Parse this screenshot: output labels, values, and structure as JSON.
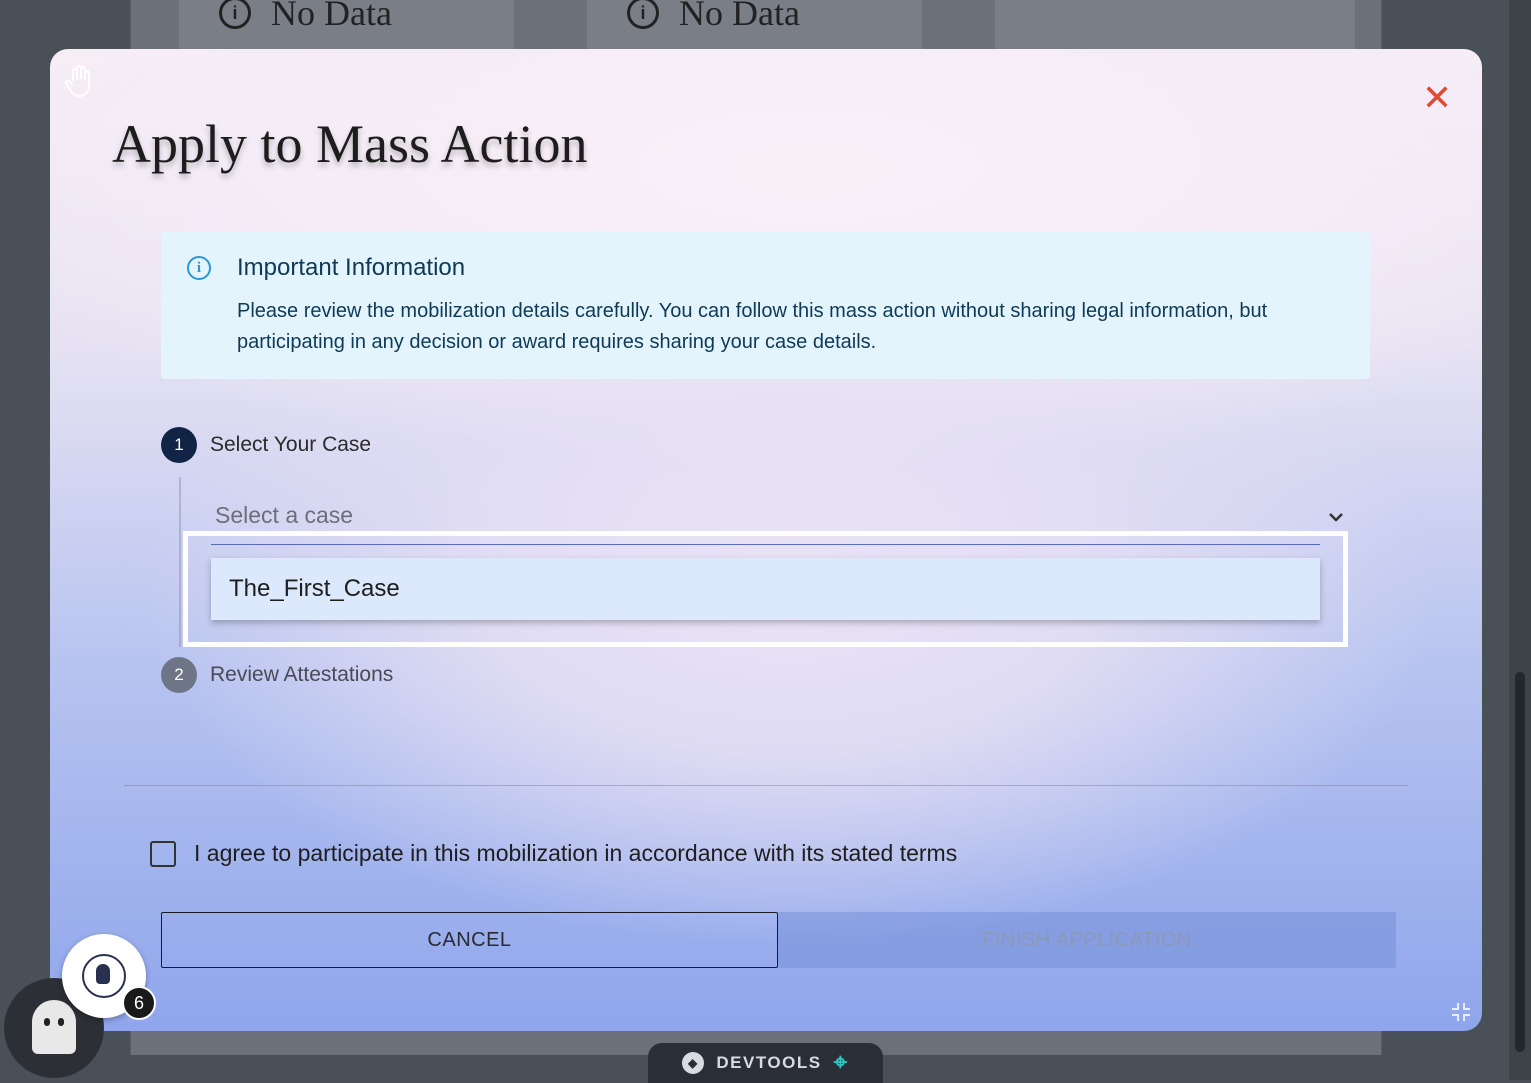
{
  "background": {
    "cards": [
      {
        "label": "No Data"
      },
      {
        "label": "No Data"
      }
    ]
  },
  "modal": {
    "title": "Apply to Mass Action",
    "close_symbol": "✕",
    "info": {
      "title": "Important Information",
      "text": "Please review the mobilization details carefully. You can follow this mass action without sharing legal information, but participating in any decision or award requires sharing your case details."
    },
    "steps": [
      {
        "number": "1",
        "label": "Select Your Case"
      },
      {
        "number": "2",
        "label": "Review Attestations"
      }
    ],
    "case_select": {
      "label": "Select a case",
      "options": [
        "The_First_Case"
      ]
    },
    "agreement": {
      "text": "I agree to participate in this mobilization in accordance with its stated terms",
      "checked": false
    },
    "buttons": {
      "cancel": "CANCEL",
      "finish": "FINISH APPLICATION"
    }
  },
  "notification_badge": "6",
  "devtools": {
    "label": "DEVTOOLS"
  },
  "icons": {
    "hand": "hand-icon",
    "close": "close-icon",
    "info": "info-icon",
    "chevron": "chevron-down-icon",
    "expand": "expand-icon",
    "shield": "shield-icon",
    "target": "target-icon"
  },
  "colors": {
    "close": "#e04a32",
    "info_bg": "#e3f4fd",
    "info_accent": "#2b95d8",
    "step_active": "#112446",
    "step_inactive": "#6d7587",
    "option_bg": "#dce8fc",
    "devtools_accent": "#2ec7c0"
  }
}
